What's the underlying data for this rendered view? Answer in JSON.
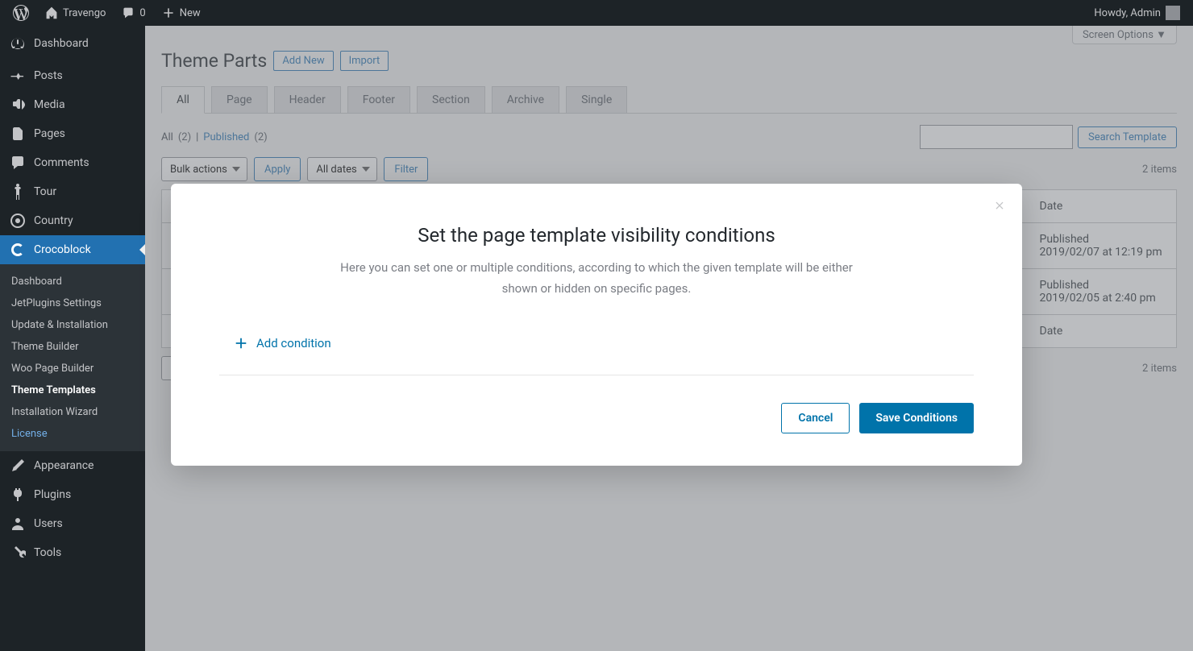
{
  "topbar": {
    "site_name": "Travengo",
    "comments_count": "0",
    "new_label": "New",
    "greeting": "Howdy, Admin"
  },
  "sidebar": {
    "items": [
      {
        "label": "Dashboard"
      },
      {
        "label": "Posts"
      },
      {
        "label": "Media"
      },
      {
        "label": "Pages"
      },
      {
        "label": "Comments"
      },
      {
        "label": "Tour"
      },
      {
        "label": "Country"
      },
      {
        "label": "Crocoblock"
      },
      {
        "label": "Appearance"
      },
      {
        "label": "Plugins"
      },
      {
        "label": "Users"
      },
      {
        "label": "Tools"
      }
    ],
    "submenu": [
      {
        "label": "Dashboard"
      },
      {
        "label": "JetPlugins Settings"
      },
      {
        "label": "Update & Installation"
      },
      {
        "label": "Theme Builder"
      },
      {
        "label": "Woo Page Builder"
      },
      {
        "label": "Theme Templates"
      },
      {
        "label": "Installation Wizard"
      },
      {
        "label": "License"
      }
    ]
  },
  "screen_options": "Screen Options ▼",
  "page": {
    "title": "Theme Parts",
    "add_new": "Add New",
    "import": "Import"
  },
  "tabs": [
    "All",
    "Page",
    "Header",
    "Footer",
    "Section",
    "Archive",
    "Single"
  ],
  "views": {
    "all_label": "All",
    "all_count": "(2)",
    "divider": "|",
    "published_label": "Published",
    "published_count": "(2)"
  },
  "search": {
    "button": "Search Template"
  },
  "bulk": {
    "bulk_actions": "Bulk actions",
    "apply": "Apply",
    "all_dates": "All dates",
    "filter": "Filter"
  },
  "items_count": "2 items",
  "table": {
    "col_date": "Date",
    "rows": [
      {
        "status": "Published",
        "date": "2019/02/07 at 12:19 pm"
      },
      {
        "status": "Published",
        "date": "2019/02/05 at 2:40 pm"
      }
    ]
  },
  "modal": {
    "title": "Set the page template visibility conditions",
    "description": "Here you can set one or multiple conditions, according to which the given template will be either shown or hidden on specific pages.",
    "add_condition": "Add condition",
    "cancel": "Cancel",
    "save": "Save Conditions"
  }
}
